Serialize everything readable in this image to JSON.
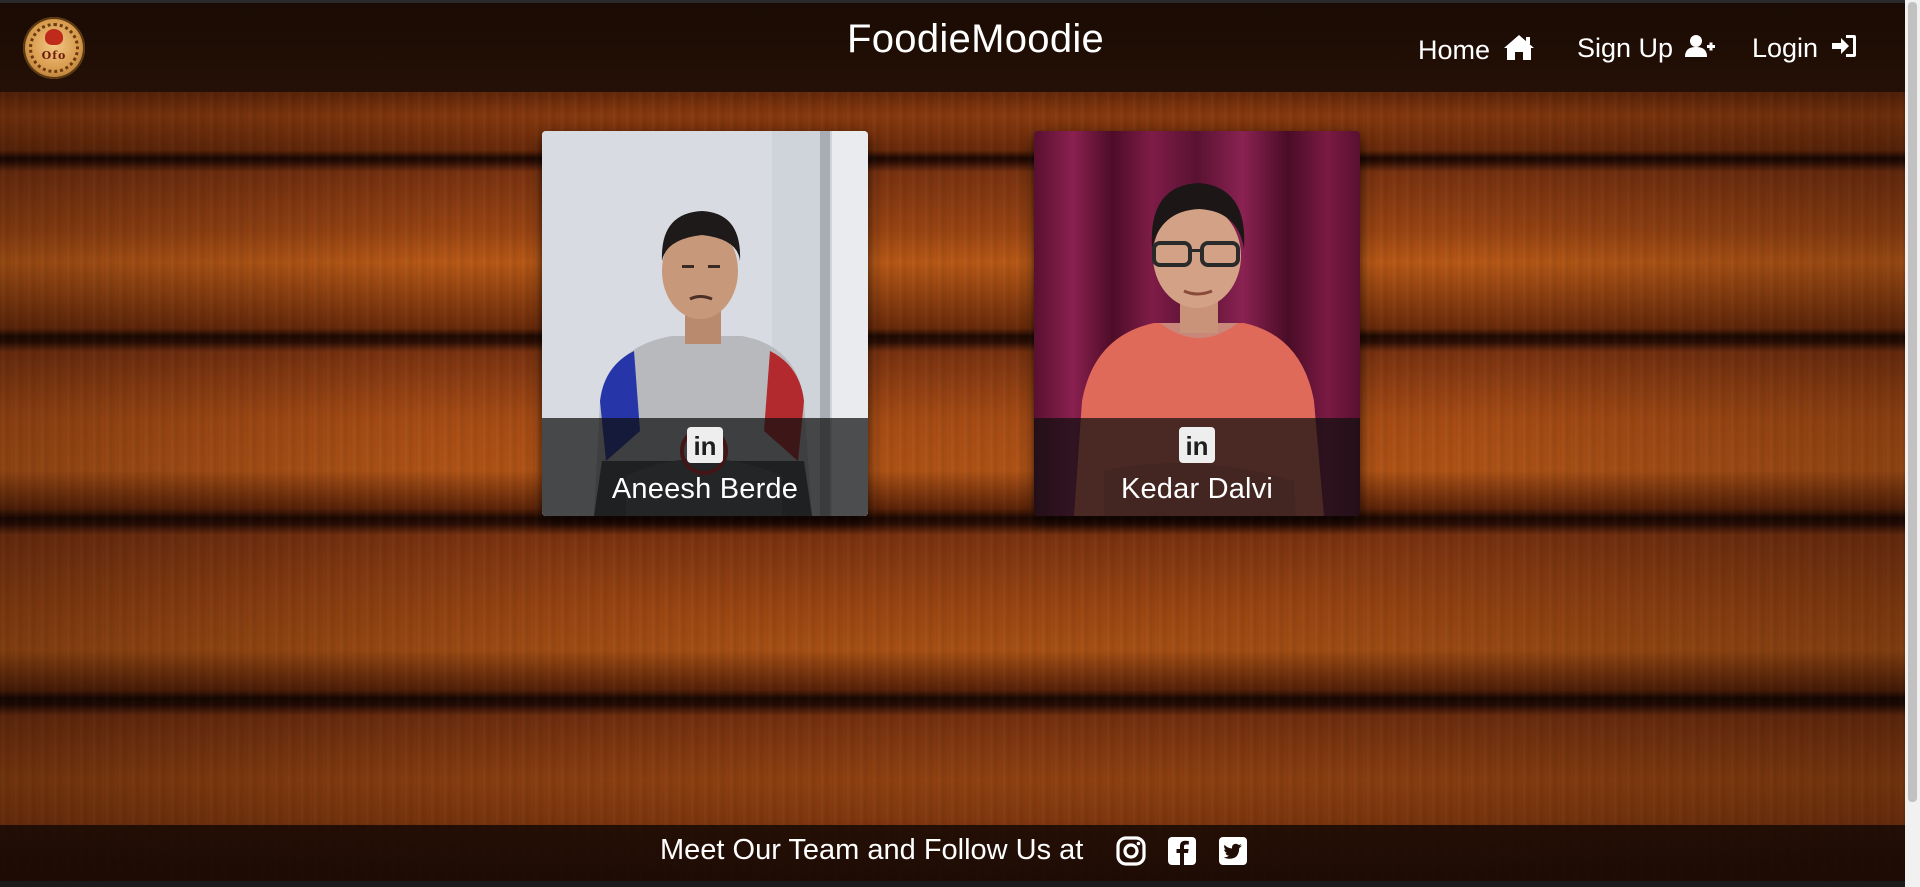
{
  "header": {
    "logo_text": "Ofo",
    "brand": "FoodieMoodie",
    "nav": [
      {
        "label": "Home",
        "icon": "home-icon"
      },
      {
        "label": "Sign Up",
        "icon": "user-plus-icon"
      },
      {
        "label": "Login",
        "icon": "sign-in-icon"
      }
    ]
  },
  "team": [
    {
      "name": "Aneesh Berde",
      "linkedin_label": "in",
      "icon": "linkedin-icon"
    },
    {
      "name": "Kedar Dalvi",
      "linkedin_label": "in",
      "icon": "linkedin-icon"
    }
  ],
  "footer": {
    "text": "Meet Our Team and Follow Us at",
    "social": [
      "instagram-icon",
      "facebook-icon",
      "twitter-icon"
    ]
  },
  "colors": {
    "navbar": "#1a0b04",
    "wood": "#9a4412",
    "text": "#ffffff"
  }
}
